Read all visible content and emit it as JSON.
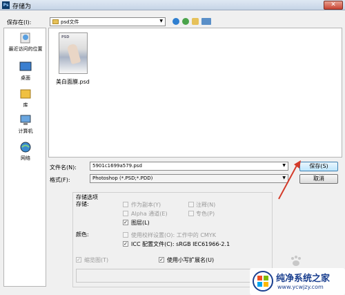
{
  "window": {
    "title": "存储为",
    "app_icon": "Ps",
    "close_label": "✕"
  },
  "header": {
    "save_in_label": "保存在(I):",
    "folder": "psd文件"
  },
  "places": [
    {
      "label": "最近访问的位置",
      "icon": "recent-places-icon"
    },
    {
      "label": "桌面",
      "icon": "desktop-icon"
    },
    {
      "label": "库",
      "icon": "libraries-icon"
    },
    {
      "label": "计算机",
      "icon": "computer-icon"
    },
    {
      "label": "网络",
      "icon": "network-icon"
    }
  ],
  "files": [
    {
      "name": "美白面膜.psd",
      "thumb_brand": "PSD"
    }
  ],
  "form": {
    "filename_label": "文件名(N):",
    "filename_value": "5901c1699a579.psd",
    "format_label": "格式(F):",
    "format_value": "Photoshop (*.PSD;*.PDD)",
    "save_button": "保存(S)",
    "cancel_button": "取消"
  },
  "options": {
    "group_title": "存储选项",
    "save_label": "存储:",
    "as_copy": "作为副本(Y)",
    "notes": "注释(N)",
    "alpha": "Alpha 通道(E)",
    "spot": "专色(P)",
    "layers": "图层(L)",
    "color_label": "颜色:",
    "proof": "使用校样设置(O): 工作中的 CMYK",
    "icc": "ICC 配置文件(C): sRGB IEC61966-2.1",
    "thumbnail": "缩览图(T)",
    "lowercase": "使用小写扩展名(U)",
    "check_mark": "✓"
  },
  "watermark": {
    "title": "纯净系统之家",
    "url": "www.ycwjzy.com"
  },
  "colors": {
    "accent": "#3c7fb1",
    "arrow": "#d43b2a",
    "watermark": "#1a3f8f"
  }
}
